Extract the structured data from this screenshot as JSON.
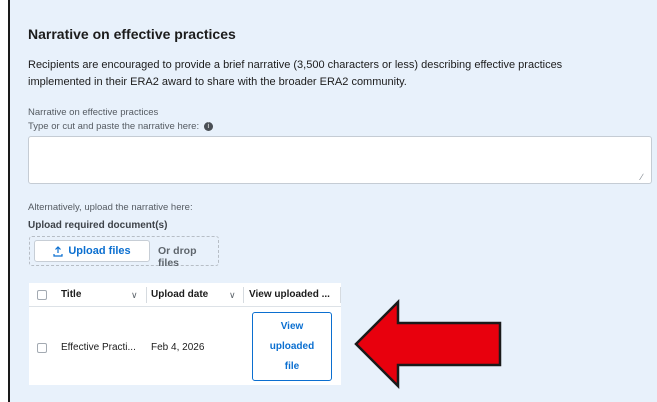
{
  "section": {
    "title": "Narrative on effective practices",
    "description": "Recipients are encouraged to provide a brief narrative (3,500 characters or less) describing effective practices implemented in their ERA2 award to share with the broader ERA2 community."
  },
  "narrative_field": {
    "label": "Narrative on effective practices",
    "sublabel": "Type or cut and paste the narrative here:",
    "info_icon": "info-icon",
    "value": ""
  },
  "upload": {
    "alt_label": "Alternatively, upload the narrative here:",
    "required_label": "Upload required document(s)",
    "button_label": "Upload files",
    "button_icon": "upload-icon",
    "drop_text": "Or drop files"
  },
  "table": {
    "columns": [
      "Title",
      "Upload date",
      "View uploaded ..."
    ],
    "rows": [
      {
        "title": "Effective Practi...",
        "date": "Feb 4, 2026",
        "action": "View uploaded file"
      }
    ]
  },
  "annotation": {
    "arrow_color": "#e8000d",
    "arrow_outline": "#1a1a1a"
  }
}
